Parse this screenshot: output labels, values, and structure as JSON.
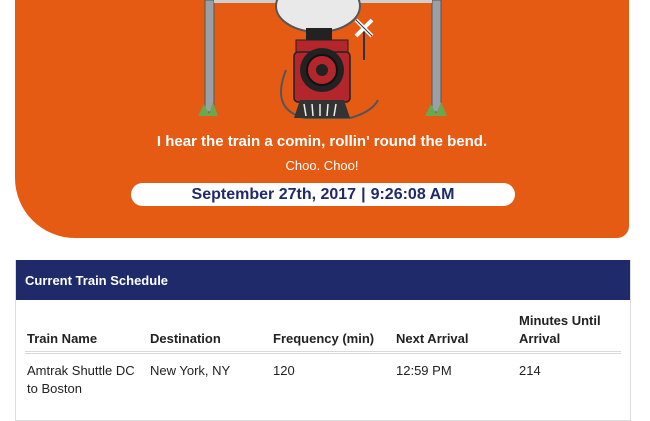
{
  "hero": {
    "tagline": "I hear the train a comin, rollin' round the bend.",
    "subline": "Choo. Choo!",
    "date": "September 27th, 2017",
    "separator": "|",
    "time": "9:26:08 AM"
  },
  "colors": {
    "hero_bg": "#e55b13",
    "header_bg": "#1f2a6b",
    "clock_text": "#1f2a6b"
  },
  "schedule": {
    "title": "Current Train Schedule",
    "columns": [
      "Train Name",
      "Destination",
      "Frequency (min)",
      "Next Arrival",
      "Minutes Until Arrival"
    ],
    "rows": [
      [
        "Amtrak Shuttle DC to Boston",
        "New York, NY",
        "120",
        "12:59 PM",
        "214"
      ]
    ]
  }
}
